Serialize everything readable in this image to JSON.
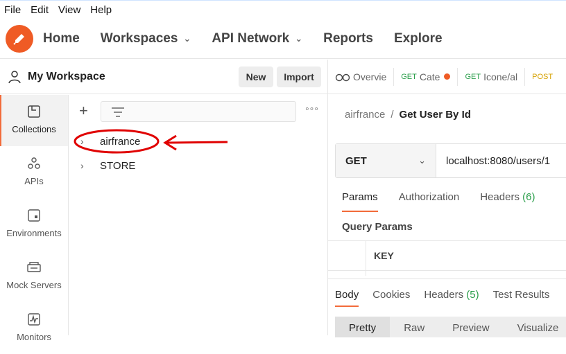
{
  "menubar": {
    "items": [
      "File",
      "Edit",
      "View",
      "Help"
    ]
  },
  "topnav": {
    "home": "Home",
    "workspaces": "Workspaces",
    "api_network": "API Network",
    "reports": "Reports",
    "explore": "Explore"
  },
  "workspace": {
    "title": "My Workspace",
    "new_label": "New",
    "import_label": "Import"
  },
  "sidebar": {
    "items": [
      {
        "label": "Collections",
        "icon": "collections-icon"
      },
      {
        "label": "APIs",
        "icon": "apis-icon"
      },
      {
        "label": "Environments",
        "icon": "environments-icon"
      },
      {
        "label": "Mock Servers",
        "icon": "mock-servers-icon"
      },
      {
        "label": "Monitors",
        "icon": "monitors-icon"
      }
    ]
  },
  "collections": {
    "items": [
      "airfrance",
      "STORE"
    ]
  },
  "tabs": {
    "overview": "Overvie",
    "tab1_method": "GET",
    "tab1_name": "Cate",
    "tab2_method": "GET",
    "tab2_name": "Icone/al",
    "tab3_method": "POST"
  },
  "request": {
    "breadcrumb_parent": "airfrance",
    "breadcrumb_sep": "/",
    "breadcrumb_current": "Get User By Id",
    "method": "GET",
    "url": "localhost:8080/users/1"
  },
  "req_tabs": {
    "params": "Params",
    "authorization": "Authorization",
    "headers": "Headers",
    "headers_count": "(6)"
  },
  "query_params": {
    "title": "Query Params",
    "key_header": "KEY"
  },
  "response": {
    "body": "Body",
    "cookies": "Cookies",
    "headers": "Headers",
    "headers_count": "(5)",
    "test_results": "Test Results"
  },
  "view_modes": {
    "pretty": "Pretty",
    "raw": "Raw",
    "preview": "Preview",
    "visualize": "Visualize"
  },
  "colors": {
    "accent": "#f26b3a",
    "logo": "#ef5b25",
    "annotation": "#e00000",
    "get": "#2a9e4a"
  }
}
